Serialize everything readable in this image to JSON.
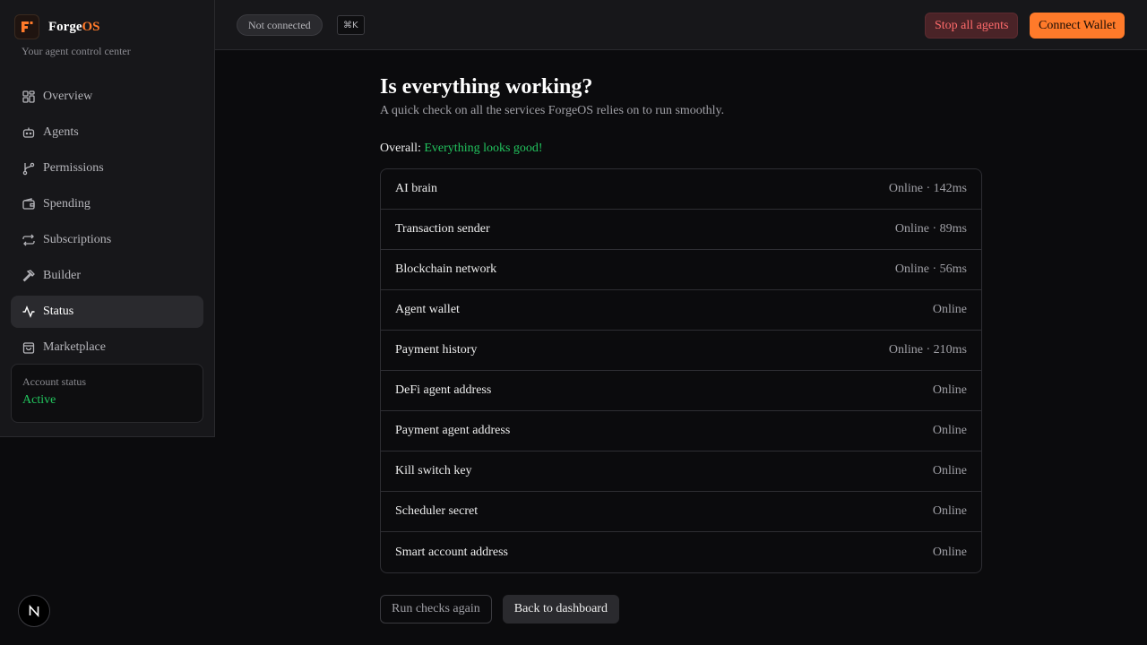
{
  "brand": {
    "name_prefix": "Forge",
    "name_suffix": "OS",
    "tagline": "Your agent control center",
    "accent": "#ff7a2a"
  },
  "sidebar": {
    "items": [
      {
        "label": "Overview",
        "icon": "grid-icon"
      },
      {
        "label": "Agents",
        "icon": "bot-icon"
      },
      {
        "label": "Permissions",
        "icon": "branch-icon"
      },
      {
        "label": "Spending",
        "icon": "wallet-icon"
      },
      {
        "label": "Subscriptions",
        "icon": "repeat-icon"
      },
      {
        "label": "Builder",
        "icon": "hammer-icon"
      },
      {
        "label": "Status",
        "icon": "activity-icon",
        "active": true
      },
      {
        "label": "Marketplace",
        "icon": "shopping-bag-icon"
      }
    ],
    "account": {
      "label": "Account status",
      "value": "Active"
    }
  },
  "topbar": {
    "connection": "Not connected",
    "shortcut": "⌘K",
    "stop_label": "Stop all agents",
    "connect_label": "Connect Wallet"
  },
  "main": {
    "title": "Is everything working?",
    "subtitle": "A quick check on all the services ForgeOS relies on to run smoothly.",
    "overall_label": "Overall:",
    "overall_value": "Everything looks good!",
    "services": [
      {
        "name": "AI brain",
        "status": "Online · 142ms"
      },
      {
        "name": "Transaction sender",
        "status": "Online · 89ms"
      },
      {
        "name": "Blockchain network",
        "status": "Online · 56ms"
      },
      {
        "name": "Agent wallet",
        "status": "Online"
      },
      {
        "name": "Payment history",
        "status": "Online · 210ms"
      },
      {
        "name": "DeFi agent address",
        "status": "Online"
      },
      {
        "name": "Payment agent address",
        "status": "Online"
      },
      {
        "name": "Kill switch key",
        "status": "Online"
      },
      {
        "name": "Scheduler secret",
        "status": "Online"
      },
      {
        "name": "Smart account address",
        "status": "Online"
      }
    ],
    "run_again_label": "Run checks again",
    "back_label": "Back to dashboard"
  },
  "badge": {
    "letter": "N"
  },
  "colors": {
    "ok": "#22c55e",
    "danger": "#ff6b6b"
  }
}
